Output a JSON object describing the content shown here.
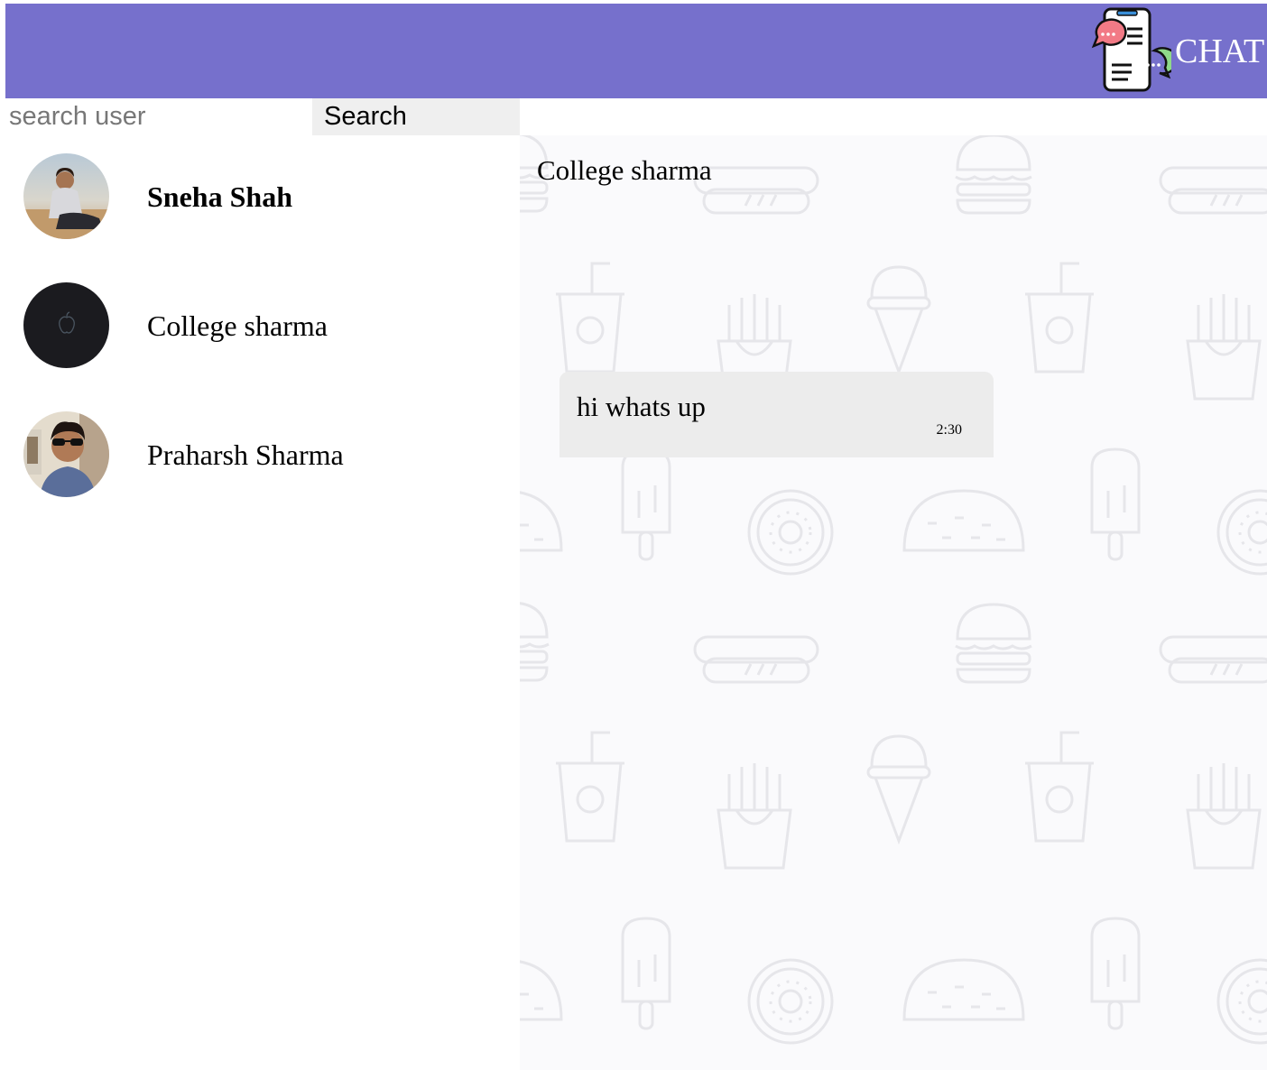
{
  "header": {
    "title": "CHAT",
    "background_color": "#7670cc",
    "logo_icon": "chat-phone-logo"
  },
  "search": {
    "placeholder": "search user",
    "value": "",
    "button_label": "Search"
  },
  "contacts": [
    {
      "name": "Sneha Shah",
      "bold": true,
      "avatar": "photo-girl-sitting"
    },
    {
      "name": "College sharma",
      "bold": false,
      "avatar": "dark-apple-logo"
    },
    {
      "name": "Praharsh Sharma",
      "bold": false,
      "avatar": "photo-man-sunglasses"
    }
  ],
  "chat": {
    "title": "College sharma",
    "background_pattern": "food-doodle-pattern",
    "messages": [
      {
        "text": "hi whats up",
        "time": "2:30"
      }
    ]
  },
  "colors": {
    "accent": "#7670cc",
    "bubble": "#ececec",
    "chat_background": "#fafafc"
  }
}
